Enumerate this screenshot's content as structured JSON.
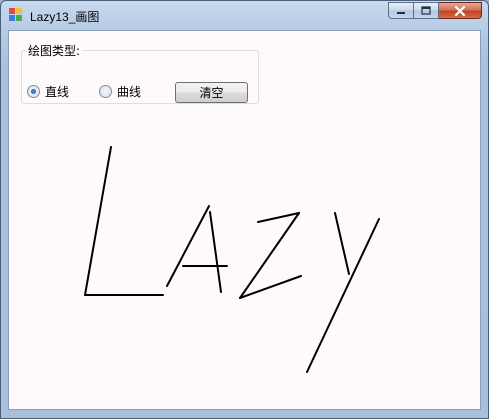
{
  "window": {
    "title": "Lazy13_画图"
  },
  "groupbox": {
    "legend": "绘图类型:"
  },
  "options": [
    {
      "label": "直线",
      "checked": true
    },
    {
      "label": "曲线",
      "checked": false
    }
  ],
  "clear_button": {
    "label": "清空"
  },
  "drawing": {
    "stroke_color": "#000000",
    "depicted_text": "Lazy"
  }
}
